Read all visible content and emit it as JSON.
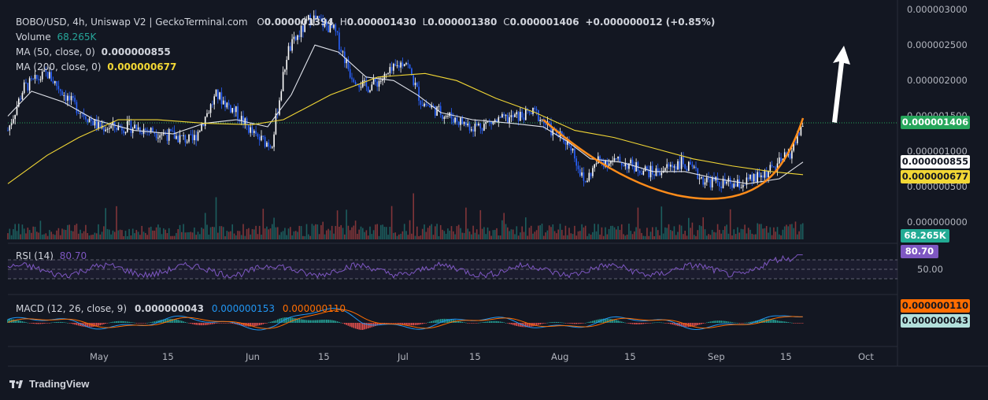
{
  "header": {
    "symbol": "BOBO/USD, 4h, Uniswap V2 | GeckoTerminal.com",
    "o_label": "O",
    "o_value": "0.000001394",
    "h_label": "H",
    "h_value": "0.000001430",
    "l_label": "L",
    "l_value": "0.000001380",
    "c_label": "C",
    "c_value": "0.000001406",
    "change": "+0.000000012 (+0.85%)"
  },
  "indicators": {
    "volume_label": "Volume",
    "volume_value": "68.265K",
    "ma50_label": "MA (50, close, 0)",
    "ma50_value": "0.000000855",
    "ma200_label": "MA (200, close, 0)",
    "ma200_value": "0.000000677",
    "rsi_label": "RSI (14)",
    "rsi_value": "80.70",
    "macd_label": "MACD (12, 26, close, 9)",
    "macd_value": "0.000000043",
    "signal_value": "0.000000153",
    "hist_value": "0.000000110"
  },
  "tags": {
    "price": "0.000001406",
    "ma50": "0.000000855",
    "ma200": "0.000000677",
    "volume": "68.265K",
    "rsi": "80.70",
    "macd_signal": "0.000000110",
    "macd": "0.000000043"
  },
  "price_axis": [
    "0.000003000",
    "0.000002500",
    "0.000002000",
    "0.000001500",
    "0.000001000",
    "0.000000500",
    "0.000000000"
  ],
  "rsi_axis": [
    "50.00"
  ],
  "time_axis": [
    "May",
    "15",
    "Jun",
    "15",
    "Jul",
    "15",
    "Aug",
    "15",
    "Sep",
    "15",
    "Oct"
  ],
  "branding": "TradingView",
  "colors": {
    "background": "#131722",
    "up": "#ffffff",
    "down": "#2962ff",
    "ma50": "#e0e3eb",
    "ma200": "#f2d735",
    "curve": "#ff8c1a",
    "rsi": "#7e57c2",
    "macd": "#2196f3",
    "signal": "#ff6d00",
    "price_tag": "#26a65b"
  },
  "chart_data": {
    "type": "line",
    "title": "BOBO/USD, 4h, Uniswap V2 | GeckoTerminal.com",
    "x": [
      "May",
      "15",
      "Jun",
      "15",
      "Jul",
      "15",
      "Aug",
      "15",
      "Sep",
      "15"
    ],
    "series": [
      {
        "name": "BOBO/USD",
        "values": [
          1.4e-06,
          1.2e-06,
          1.4e-06,
          2.7e-06,
          2e-06,
          1.3e-06,
          8e-07,
          8e-07,
          5.5e-07,
          1.406e-06
        ]
      },
      {
        "name": "MA (50, close, 0)",
        "values": [
          1.7e-06,
          1.3e-06,
          1.3e-06,
          2.5e-06,
          2e-06,
          1.5e-06,
          9.5e-07,
          7.8e-07,
          6e-07,
          8.55e-07
        ]
      },
      {
        "name": "MA (200, close, 0)",
        "values": [
          1.2e-06,
          1.4e-06,
          1.4e-06,
          1.6e-06,
          1.9e-06,
          1.8e-06,
          1.3e-06,
          9.5e-07,
          7e-07,
          6.77e-07
        ]
      }
    ],
    "ylim": [
      0,
      3e-06
    ],
    "ylabel": "",
    "xlabel": ""
  }
}
